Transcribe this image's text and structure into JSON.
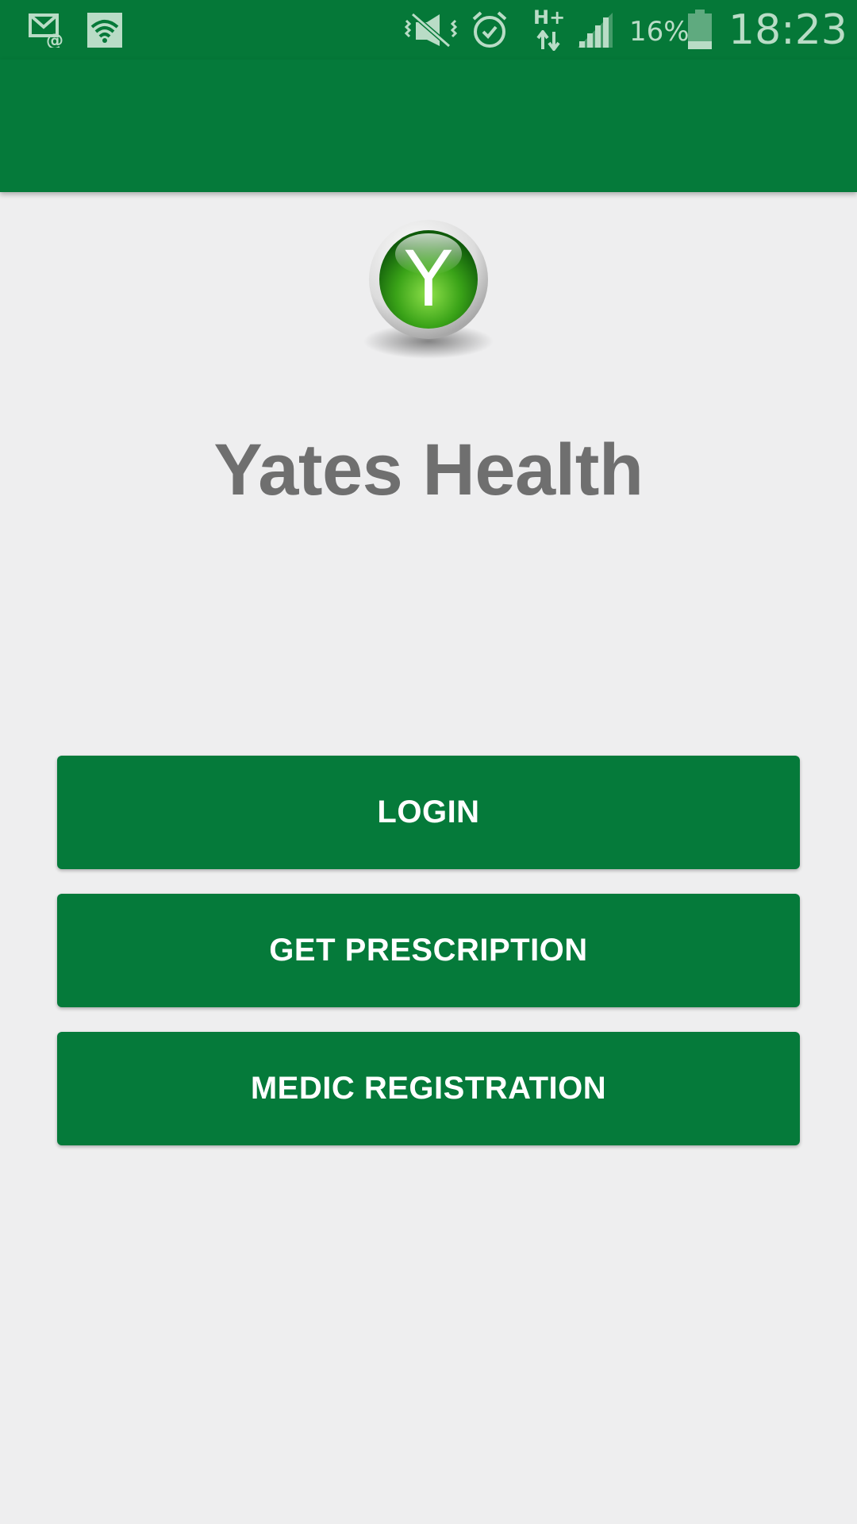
{
  "status_bar": {
    "battery_percent": "16%",
    "time": "18:23",
    "network_type": "H+",
    "icons": [
      "email-at-notification-icon",
      "wifi-notification-icon",
      "vibrate-icon",
      "alarm-icon",
      "data-arrows-icon",
      "signal-icon",
      "battery-icon"
    ]
  },
  "app": {
    "title": "Yates Health",
    "logo_letter": "Y"
  },
  "buttons": {
    "login": "LOGIN",
    "get_prescription": "GET PRESCRIPTION",
    "medic_registration": "MEDIC REGISTRATION"
  },
  "colors": {
    "primary": "#057a3a",
    "background": "#eeeeef",
    "title_text": "#6f6f6f",
    "button_text": "#ffffff"
  }
}
